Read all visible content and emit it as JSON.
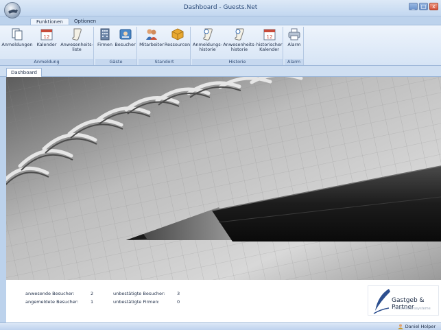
{
  "window": {
    "title": "Dashboard - Guests.Net",
    "minimize_label": "_",
    "maximize_label": "□",
    "close_label": "x"
  },
  "ribbon_tabs": [
    {
      "label": "Funktionen",
      "active": true
    },
    {
      "label": "Optionen",
      "active": false
    }
  ],
  "ribbon": {
    "groups": [
      {
        "label": "Anmeldung",
        "buttons": [
          {
            "label": "Anmeldungen",
            "icon": "documents-icon"
          },
          {
            "label": "Kalender",
            "icon": "calendar-icon",
            "icon_text": "12"
          },
          {
            "label": "Anwesenheits-\nliste",
            "icon": "scroll-icon"
          }
        ]
      },
      {
        "label": "Gäste",
        "buttons": [
          {
            "label": "Firmen",
            "icon": "building-icon"
          },
          {
            "label": "Besucher",
            "icon": "visitor-card-icon"
          }
        ]
      },
      {
        "label": "Standort",
        "buttons": [
          {
            "label": "Mitarbeiter",
            "icon": "employees-icon"
          },
          {
            "label": "Ressourcen",
            "icon": "box-icon"
          }
        ]
      },
      {
        "label": "Historie",
        "buttons": [
          {
            "label": "Anmeldungs-\nhistorie",
            "icon": "history-scroll-icon"
          },
          {
            "label": "Anwesenheits-\nhistorie",
            "icon": "history-scroll-icon"
          },
          {
            "label": "historischer\nKalender",
            "icon": "calendar-icon",
            "icon_text": "12"
          }
        ]
      },
      {
        "label": "Alarm",
        "buttons": [
          {
            "label": "Alarm",
            "icon": "printer-icon"
          }
        ]
      }
    ]
  },
  "document_tab": {
    "label": "Dashboard"
  },
  "stats": {
    "anwesende_label": "anwesende Besucher:",
    "anwesende_value": "2",
    "angemeldete_label": "angemeldete Besucher:",
    "angemeldete_value": "1",
    "unbestaetigte_besucher_label": "unbestätigte Besucher:",
    "unbestaetigte_besucher_value": "3",
    "unbestaetigte_firmen_label": "unbestätigte Firmen:",
    "unbestaetigte_firmen_value": "0"
  },
  "logo": {
    "name": "Gastgeb & Partner",
    "tagline": "Informationssysteme"
  },
  "statusbar": {
    "user": "Daniel Holper"
  },
  "colors": {
    "accent": "#2b4a78",
    "ribbon_bg": "#d6e4f5",
    "group_label_bg": "#c6d8ef"
  }
}
